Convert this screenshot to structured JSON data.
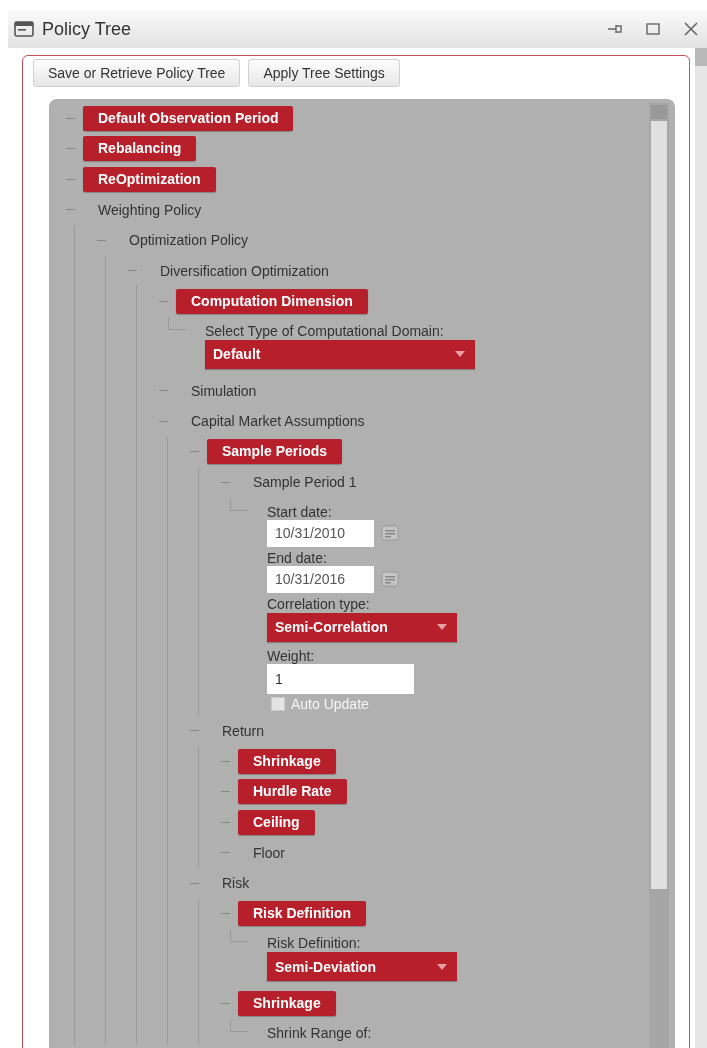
{
  "window": {
    "title": "Policy Tree"
  },
  "toolbar": {
    "buttons": [
      "Save or Retrieve Policy Tree",
      "Apply Tree Settings"
    ]
  },
  "tree": [
    {
      "label": "Default Observation Period",
      "highlighted": true
    },
    {
      "label": "Rebalancing",
      "highlighted": true
    },
    {
      "label": "ReOptimization",
      "highlighted": true
    },
    {
      "label": "Weighting Policy",
      "highlighted": false,
      "children": [
        {
          "label": "Optimization Policy",
          "highlighted": false,
          "children": [
            {
              "label": "Diversification Optimization",
              "highlighted": false,
              "children": [
                {
                  "label": "Computation Dimension",
                  "highlighted": true,
                  "form": [
                    {
                      "kind": "label",
                      "text": "Select Type of Computational Domain:"
                    },
                    {
                      "kind": "select",
                      "value": "Default"
                    }
                  ]
                },
                {
                  "label": "Simulation",
                  "highlighted": false
                },
                {
                  "label": "Capital Market Assumptions",
                  "highlighted": false,
                  "children": [
                    {
                      "label": "Sample Periods",
                      "highlighted": true,
                      "children": [
                        {
                          "label": "Sample Period 1",
                          "highlighted": false,
                          "form": [
                            {
                              "kind": "label",
                              "text": "Start date:"
                            },
                            {
                              "kind": "date",
                              "value": "10/31/2010"
                            },
                            {
                              "kind": "label",
                              "text": "End date:"
                            },
                            {
                              "kind": "date",
                              "value": "10/31/2016"
                            },
                            {
                              "kind": "label",
                              "text": "Correlation type:"
                            },
                            {
                              "kind": "select",
                              "value": "Semi-Correlation"
                            },
                            {
                              "kind": "label",
                              "text": "Weight:"
                            },
                            {
                              "kind": "input",
                              "value": "1"
                            },
                            {
                              "kind": "checkbox",
                              "label": "Auto Update",
                              "checked": false,
                              "disabled": true
                            }
                          ]
                        }
                      ]
                    },
                    {
                      "label": "Return",
                      "highlighted": false,
                      "children": [
                        {
                          "label": "Shrinkage",
                          "highlighted": true
                        },
                        {
                          "label": "Hurdle Rate",
                          "highlighted": true
                        },
                        {
                          "label": "Ceiling",
                          "highlighted": true
                        },
                        {
                          "label": "Floor",
                          "highlighted": false
                        }
                      ]
                    },
                    {
                      "label": "Risk",
                      "highlighted": false,
                      "children": [
                        {
                          "label": "Risk Definition",
                          "highlighted": true,
                          "form": [
                            {
                              "kind": "label",
                              "text": "Risk Definition:"
                            },
                            {
                              "kind": "select",
                              "value": "Semi-Deviation"
                            }
                          ]
                        },
                        {
                          "label": "Shrinkage",
                          "highlighted": true,
                          "form": [
                            {
                              "kind": "label",
                              "text": "Shrink Range of:"
                            }
                          ]
                        }
                      ]
                    }
                  ]
                }
              ]
            }
          ]
        }
      ]
    }
  ]
}
